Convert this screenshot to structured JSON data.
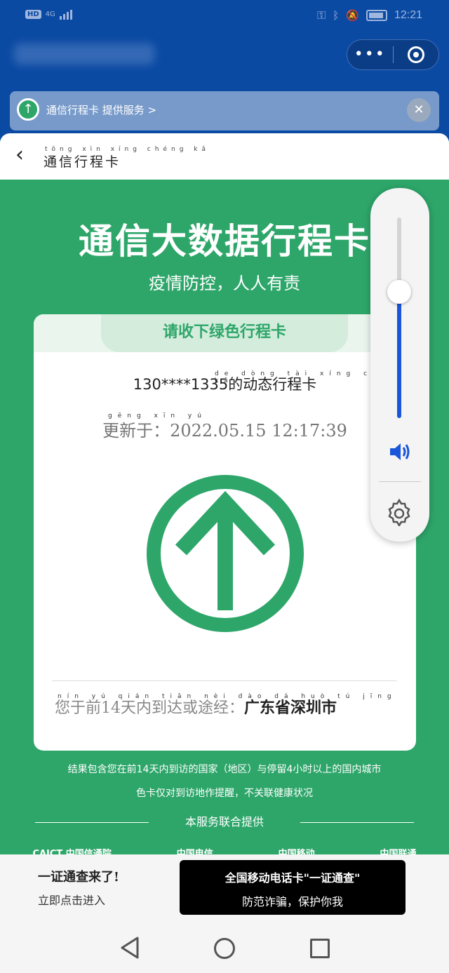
{
  "status_bar": {
    "network_badge": "HD",
    "network_type": "4G",
    "time": "12:21"
  },
  "capsule": {
    "more_icon": "more-dots-icon",
    "close_icon": "target-circle-icon"
  },
  "notice": {
    "logo_icon": "green-arrow-logo-icon",
    "text": "通信行程卡 提供服务 >",
    "close_label": "✕"
  },
  "header": {
    "back_label": "‹",
    "title_pinyin": "tōng xìn xíng chéng kǎ",
    "title": "通信行程卡"
  },
  "main": {
    "title": "通信大数据行程卡",
    "subtitle": "疫情防控，人人有责"
  },
  "card": {
    "tab_label": "请收下绿色行程卡",
    "phone_pinyin": "de dòng tài xíng chéng kǎ",
    "phone_text": "130****1335的动态行程卡",
    "updated_pinyin": "gēng xīn yú",
    "updated_text": "更新于：2022.05.15 12:17:39",
    "status_color": "#2ea66a",
    "visited_pinyin": "nín yú qián tiān nèi dào dá huò tú jīng",
    "visited_prefix": "您于前14天内到达或途经：",
    "visited_places": "广东省深圳市"
  },
  "notes": {
    "line1": "结果包含您在前14天内到访的国家（地区）与停留4小时以上的国内城市",
    "line2": "色卡仅对到访地作提醒，不关联健康状况",
    "sponsor": "本服务联合提供"
  },
  "partners": [
    "CAICT 中国信通院",
    "中国电信",
    "中国移动",
    "中国联通"
  ],
  "volume_panel": {
    "level": 0.63,
    "speaker_icon": "speaker-icon",
    "settings_icon": "gear-icon"
  },
  "banner": {
    "left_line1": "一证通查来了!",
    "left_line2": "立即点击进入",
    "right_line1": "全国移动电话卡\"一证通查\"",
    "right_line2": "防范诈骗，保护你我"
  },
  "navbar": {
    "back_icon": "nav-back-icon",
    "home_icon": "nav-home-icon",
    "recent_icon": "nav-recent-icon"
  }
}
